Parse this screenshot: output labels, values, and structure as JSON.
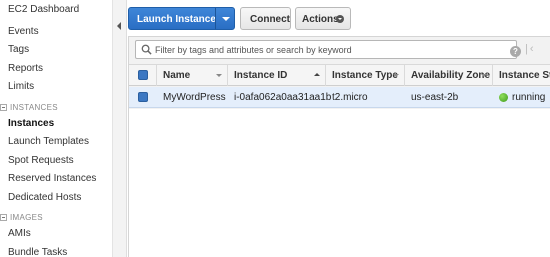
{
  "sidebar": {
    "items": [
      {
        "label": "EC2 Dashboard"
      },
      {
        "label": "Events"
      },
      {
        "label": "Tags"
      },
      {
        "label": "Reports"
      },
      {
        "label": "Limits"
      }
    ],
    "sections": [
      {
        "title": "INSTANCES",
        "items": [
          {
            "label": "Instances",
            "active": true
          },
          {
            "label": "Launch Templates"
          },
          {
            "label": "Spot Requests"
          },
          {
            "label": "Reserved Instances"
          },
          {
            "label": "Dedicated Hosts"
          }
        ]
      },
      {
        "title": "IMAGES",
        "items": [
          {
            "label": "AMIs"
          },
          {
            "label": "Bundle Tasks"
          }
        ]
      }
    ]
  },
  "toolbar": {
    "launch_label": "Launch Instance",
    "connect_label": "Connect",
    "actions_label": "Actions"
  },
  "search": {
    "placeholder": "Filter by tags and attributes or search by keyword"
  },
  "table": {
    "columns": [
      "Name",
      "Instance ID",
      "Instance Type",
      "Availability Zone",
      "Instance State"
    ],
    "rows": [
      {
        "name": "MyWordPress",
        "instance_id": "i-0afa062a0aa31aa1b",
        "instance_type": "t2.micro",
        "availability_zone": "us-east-2b",
        "state": "running"
      }
    ]
  },
  "colors": {
    "primary_button": "#2f76cc",
    "running_status": "#4caf2a",
    "selected_row": "#e4eefb"
  }
}
